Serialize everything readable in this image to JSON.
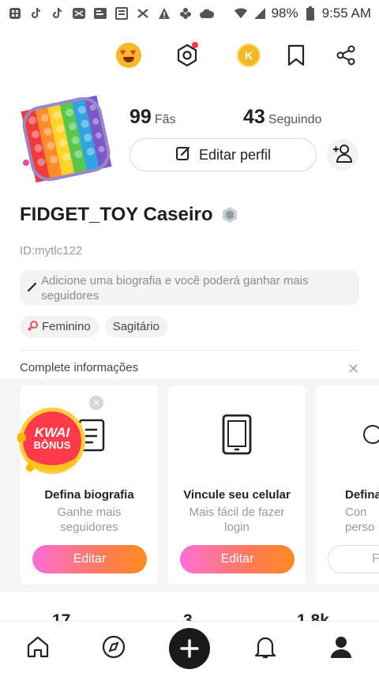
{
  "status_bar": {
    "battery": "98%",
    "time": "9:55 AM",
    "icons": [
      "grid-icon",
      "tiktok-icon",
      "tiktok-icon",
      "mail-icon",
      "chat-icon",
      "news-icon",
      "cross-icon",
      "warning-icon",
      "flower-icon",
      "cloud-icon",
      "wifi-icon",
      "signal-icon",
      "battery-icon"
    ]
  },
  "top_bar": {
    "icons": [
      "heart-eyes-emoji-icon",
      "settings-hexagon-icon",
      "coin-icon",
      "bookmark-icon",
      "share-icon"
    ],
    "coin_letter": "K"
  },
  "profile": {
    "fans_count": "99",
    "fans_label": "Fãs",
    "following_count": "43",
    "following_label": "Seguindo",
    "edit_button_label": "Editar perfil",
    "username": "FIDGET_TOY Caseiro",
    "user_id": "ID:mytlc122",
    "bio_placeholder": "Adicione uma biografia e você poderá ganhar mais seguidores",
    "tags": [
      {
        "label": "Feminino",
        "icon": "female-icon"
      },
      {
        "label": "Sagitário",
        "icon": ""
      }
    ]
  },
  "complete_info": {
    "title": "Complete informações",
    "cards": [
      {
        "title": "Defina biografia",
        "subtitle": "Ganhe mais seguidores",
        "button": "Editar"
      },
      {
        "title": "Vincule seu celular",
        "subtitle": "Mais fácil de fazer login",
        "button": "Editar"
      },
      {
        "title": "Defina",
        "subtitle": "Con perso",
        "button": "Fe"
      }
    ]
  },
  "kwai_bonus": {
    "line1": "KWAI",
    "line2": "BÔNUS"
  },
  "peek_stats": [
    "17",
    "3",
    "1,8k"
  ],
  "bottom_nav": {
    "items": [
      "home-icon",
      "discover-icon",
      "create-icon",
      "notifications-icon",
      "profile-icon"
    ]
  },
  "colors": {
    "button_gradient_start": "#ff6fd8",
    "button_gradient_end": "#ff8a1e",
    "notification_dot": "#ff3b3b"
  }
}
